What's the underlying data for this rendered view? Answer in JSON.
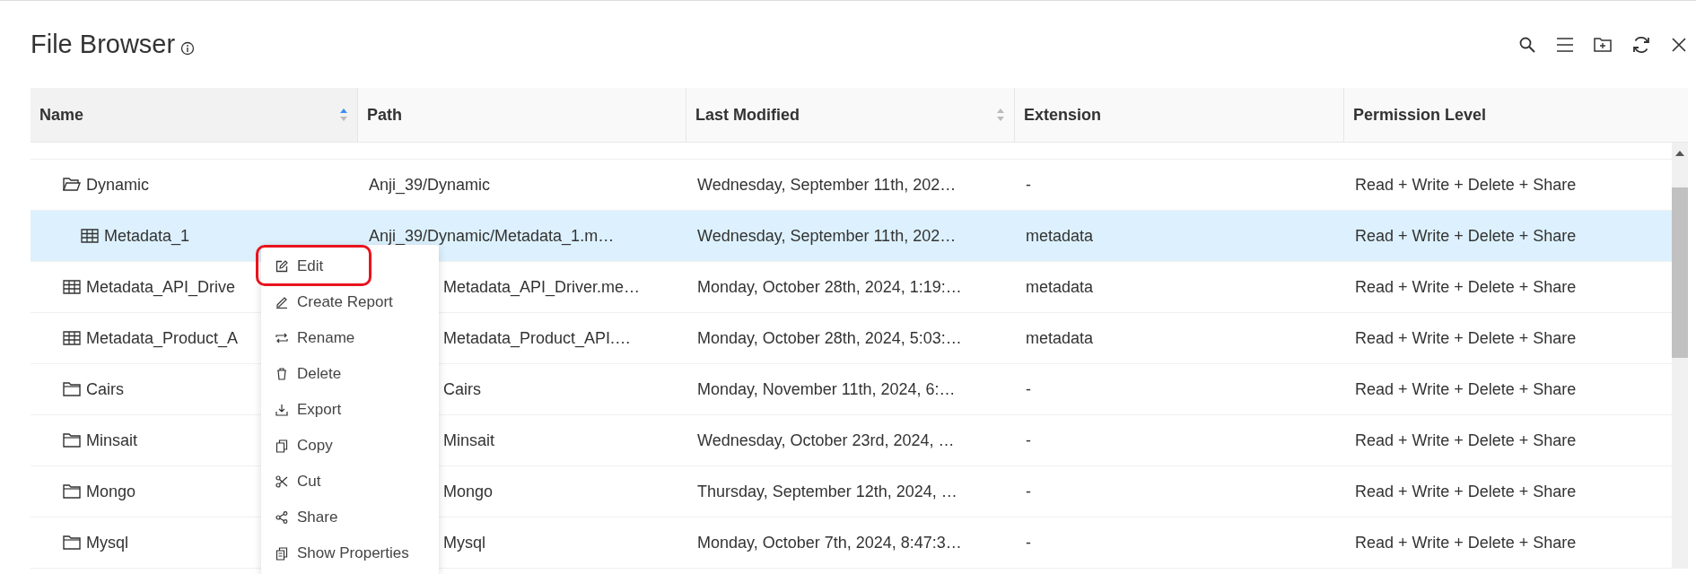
{
  "title": "File Browser",
  "toolbar": [
    {
      "kind": "search"
    },
    {
      "kind": "menu"
    },
    {
      "kind": "new-folder"
    },
    {
      "kind": "refresh"
    },
    {
      "kind": "close"
    }
  ],
  "columns": [
    {
      "label": "Name",
      "sortable": true,
      "sorted": true
    },
    {
      "label": "Path",
      "sortable": false
    },
    {
      "label": "Last Modified",
      "sortable": true,
      "sorted": false
    },
    {
      "label": "Extension",
      "sortable": false
    },
    {
      "label": "Permission Level",
      "sortable": false
    }
  ],
  "rows": [
    {
      "kind": "folder",
      "name": "Dynamic",
      "path": "Anji_39/Dynamic",
      "modified": "Wednesday, September 11th, 202…",
      "extension": "-",
      "permission": "Read + Write + Delete + Share",
      "selected": false,
      "expanded": true,
      "children": [
        {
          "kind": "table",
          "name": "Metadata_1",
          "path": "Anji_39/Dynamic/Metadata_1.m…",
          "modified": "Wednesday, September 11th, 202…",
          "extension": "metadata",
          "permission": "Read + Write + Delete + Share",
          "selected": true
        }
      ]
    },
    {
      "kind": "table",
      "name": "Metadata_API_Drive",
      "path": "Metadata_API_Driver.me…",
      "modified": "Monday, October 28th, 2024, 1:19:…",
      "extension": "metadata",
      "permission": "Read + Write + Delete + Share",
      "selected": false
    },
    {
      "kind": "table",
      "name": "Metadata_Product_A",
      "path": "Metadata_Product_API.…",
      "modified": "Monday, October 28th, 2024, 5:03:…",
      "extension": "metadata",
      "permission": "Read + Write + Delete + Share",
      "selected": false
    },
    {
      "kind": "folder",
      "name": "Cairs",
      "path": "Cairs",
      "modified": "Monday, November 11th, 2024, 6:…",
      "extension": "-",
      "permission": "Read + Write + Delete + Share",
      "selected": false,
      "expanded": false
    },
    {
      "kind": "folder",
      "name": "Minsait",
      "path": "Minsait",
      "modified": "Wednesday, October 23rd, 2024, …",
      "extension": "-",
      "permission": "Read + Write + Delete + Share",
      "selected": false,
      "expanded": false
    },
    {
      "kind": "folder",
      "name": "Mongo",
      "path": "Mongo",
      "modified": "Thursday, September 12th, 2024, …",
      "extension": "-",
      "permission": "Read + Write + Delete + Share",
      "selected": false,
      "expanded": false
    },
    {
      "kind": "folder",
      "name": "Mysql",
      "path": "Mysql",
      "modified": "Monday, October 7th, 2024, 8:47:3…",
      "extension": "-",
      "permission": "Read + Write + Delete + Share",
      "selected": false,
      "expanded": false
    }
  ],
  "context_menu": [
    {
      "kind": "edit",
      "label": "Edit",
      "highlighted": true
    },
    {
      "kind": "report",
      "label": "Create Report",
      "highlighted": false
    },
    {
      "kind": "rename",
      "label": "Rename",
      "highlighted": false
    },
    {
      "kind": "delete",
      "label": "Delete",
      "highlighted": false
    },
    {
      "kind": "export",
      "label": "Export",
      "highlighted": false
    },
    {
      "kind": "copy",
      "label": "Copy",
      "highlighted": false
    },
    {
      "kind": "cut",
      "label": "Cut",
      "highlighted": false
    },
    {
      "kind": "share",
      "label": "Share",
      "highlighted": false
    },
    {
      "kind": "properties",
      "label": "Show Properties",
      "highlighted": false
    }
  ]
}
